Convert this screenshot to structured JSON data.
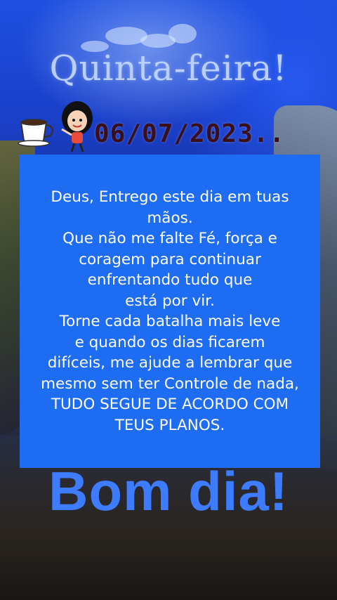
{
  "greeting": {
    "day": "Quinta-feira!",
    "date": "06/07/2023.."
  },
  "message": {
    "lines": [
      "Deus, Entrego este dia em tuas",
      "mãos.",
      "Que não me falte Fé, força e",
      "coragem para continuar",
      "enfrentando tudo que",
      "está por vir.",
      "Torne cada batalha mais leve",
      "e quando os dias ficarem",
      "difíceis, me ajude a lembrar que",
      "mesmo sem ter Controle de nada,",
      "TUDO SEGUE DE ACORDO COM",
      "TEUS PLANOS."
    ]
  },
  "footer": {
    "text": "Bom dia!"
  },
  "colors": {
    "box": "#1d6cf2",
    "title": "#b9d0ff",
    "footer": "#3d7bff",
    "date": "#3a0f1a"
  },
  "icons": [
    "coffee-cup-icon",
    "cartoon-girl-icon"
  ]
}
